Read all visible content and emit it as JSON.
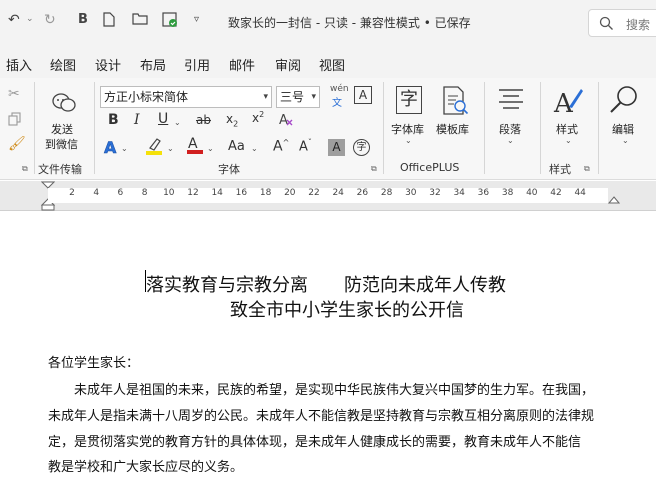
{
  "titlebar": {
    "title": "致家长的一封信 - 只读 - 兼容性模式 • 已保存",
    "search_placeholder": "搜索"
  },
  "quick_access": [
    "undo-icon",
    "redo-icon",
    "bold-icon",
    "new-doc-icon",
    "open-folder-icon",
    "save-icon",
    "customize-icon"
  ],
  "tabs": [
    "插入",
    "绘图",
    "设计",
    "布局",
    "引用",
    "邮件",
    "审阅",
    "视图"
  ],
  "ribbon": {
    "send_wechat_line1": "发送",
    "send_wechat_line2": "到微信",
    "file_transfer_label": "文件传输",
    "font_name": "方正小标宋简体",
    "font_size": "三号",
    "font_group_label": "字体",
    "wen": "文",
    "font_lib": "字体库",
    "template_lib": "模板库",
    "officeplus_label": "OfficePLUS",
    "paragraph": "段落",
    "styles": "样式",
    "styles_group_label": "样式",
    "edit": "编辑",
    "zi": "字",
    "aa": "Aa",
    "boxed_a": "A",
    "circled_zi": "字"
  },
  "ruler": {
    "ticks": [
      "2",
      "4",
      "6",
      "8",
      "10",
      "12",
      "14",
      "16",
      "18",
      "20",
      "22",
      "24",
      "26",
      "28",
      "30",
      "32",
      "34",
      "36",
      "38",
      "40",
      "42",
      "44"
    ]
  },
  "document": {
    "title_line1": "落实教育与宗教分离　　防范向未成年人传教",
    "title_line2": "致全市中小学生家长的公开信",
    "salutation": "各位学生家长：",
    "body_lines": [
      "　　未成年人是祖国的未来，民族的希望，是实现中华民族伟大复兴中国梦的生力军。在我国，",
      "未成年人是指未满十八周岁的公民。未成年人不能信教是坚持教育与宗教互相分离原则的法律规",
      "定，是贯彻落实党的教育方针的具体体现，是未成年人健康成长的需要，教育未成年人不能信",
      "教是学校和广大家长应尽的义务。"
    ]
  },
  "colors": {
    "highlight": "#f5e10a",
    "font_color": "#d11f1f",
    "text_effect": "#2b6fd6"
  }
}
